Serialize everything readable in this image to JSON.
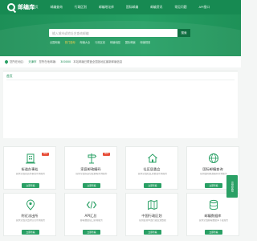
{
  "brand": {
    "name": "邮编库"
  },
  "nav": {
    "items": [
      "首页",
      "邮编查询",
      "行政区划",
      "邮编地址库",
      "国际邮编",
      "邮编资讯",
      "常见问题",
      "API接口"
    ]
  },
  "search": {
    "placeholder": "输入城市或地址名查询邮编",
    "button": "搜索",
    "hot_links": [
      "全国邮编",
      "热门查询",
      "邮编大全",
      "行政区划",
      "邮编地图",
      "国际邮编",
      "邮编规则"
    ]
  },
  "location": {
    "label": "您所在地区：",
    "city": "天津市",
    "code_label": "您所在地邮编：",
    "code": "300000",
    "note": "本站邮编已覆盖全国各地区最新邮编信息"
  },
  "section": {
    "title": "首页"
  },
  "services": [
    {
      "title": "街道办事处",
      "desc": "提供全国街道办事处查询服务",
      "button": "立即查看",
      "badge": "HOT",
      "icon": "building-pin-icon"
    },
    {
      "title": "家庭邮政编码",
      "desc": "提供全国家庭住址邮编查询服务",
      "button": "立即查看",
      "badge": "HOT",
      "icon": "signpost-icon"
    },
    {
      "title": "社区居委会",
      "desc": "提供全国社区居委会查询服务",
      "button": "立即查看",
      "badge": "",
      "icon": "home-icon"
    },
    {
      "title": "国际邮编查询",
      "desc": "提供国际邮政编码查询服务",
      "button": "立即查看",
      "badge": "",
      "icon": "globe-icon"
    },
    {
      "title": "附近派出所",
      "desc": "提供全国派出所信息查询服务",
      "button": "立即查看",
      "badge": "",
      "icon": "police-pin-icon"
    },
    {
      "title": "API汇总",
      "desc": "邮编数据接口调用服务",
      "button": "立即查看",
      "badge": "",
      "icon": "api-icon"
    },
    {
      "title": "中国行政区划",
      "desc": "提供最新中国行政区划数据",
      "button": "立即查看",
      "badge": "",
      "icon": "map-icon"
    },
    {
      "title": "邮编数据库",
      "desc": "提供全国邮编数据库下载服务",
      "button": "立即查看",
      "badge": "",
      "icon": "database-icon"
    }
  ],
  "float": {
    "label": "意见反馈"
  },
  "colors": {
    "primary": "#178a52",
    "accent": "#2aa065",
    "badge": "#e64b35"
  }
}
